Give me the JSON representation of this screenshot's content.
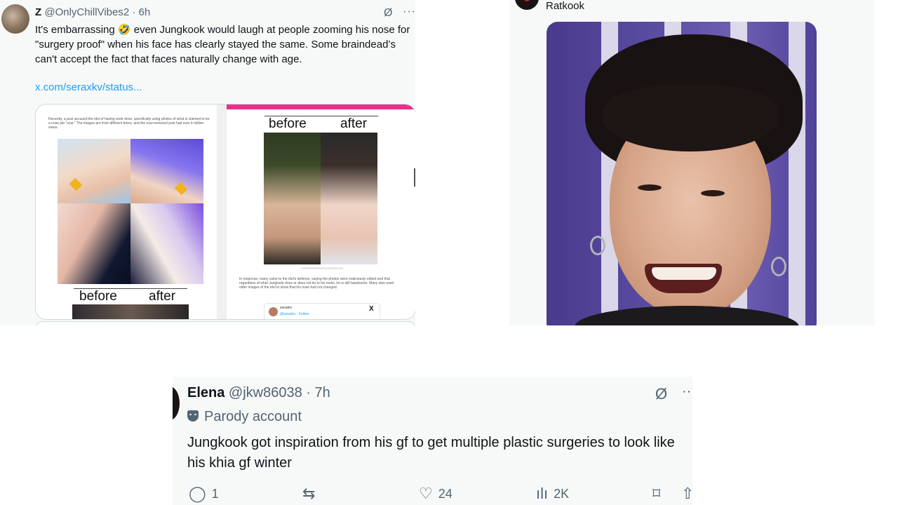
{
  "tweet1": {
    "name": "Z",
    "handle": "@OnlyChillVibes2",
    "separator": "·",
    "time": "6h",
    "grok_icon": "Ø",
    "more_icon": "···",
    "text": "It's embarrassing 🤣 even Jungkook would laugh at people zooming his nose for \"surgery proof\" when his face has clearly stayed the same. Some braindead’s can't accept the fact that faces naturally change with age.",
    "link": "x.com/seraxkv/status...",
    "card": {
      "left_text": "Recently, a post accused the idol of having work done, specifically using photos of what is claimed to be a nose job \"scar.\" The images are from different times, and the now-removed post had over 4 million views.",
      "left_before": "before",
      "left_after": "after",
      "right_before": "before",
      "right_after": "after",
      "right_text": "In response, many came to the idol's defense, saying the photos were maliciously edited and that regardless of what Jungkook does or does not do to his looks, he is still handsome. Many also used older images of the idol to show that his nose had not changed.",
      "embed_name": "seraxkv",
      "embed_follow": "@seraxkv · Follow",
      "embed_x": "X"
    }
  },
  "tweet2": {
    "username": "Ratkook"
  },
  "tweet3": {
    "name": "Elena",
    "handle": "@jkw86038",
    "separator": "·",
    "time": "7h",
    "grok_icon": "Ø",
    "more_icon": "··",
    "label": "Parody account",
    "text": "Jungkook got inspiration from his gf to get multiple plastic surgeries to look like his khia gf winter",
    "actions": {
      "reply_icon": "◯",
      "replies": "1",
      "retweet_icon": "⇆",
      "like_icon": "♡",
      "likes": "24",
      "views_icon": "ılı",
      "views": "2K",
      "bookmark_icon": "⌑",
      "share_icon": "⇧"
    }
  }
}
